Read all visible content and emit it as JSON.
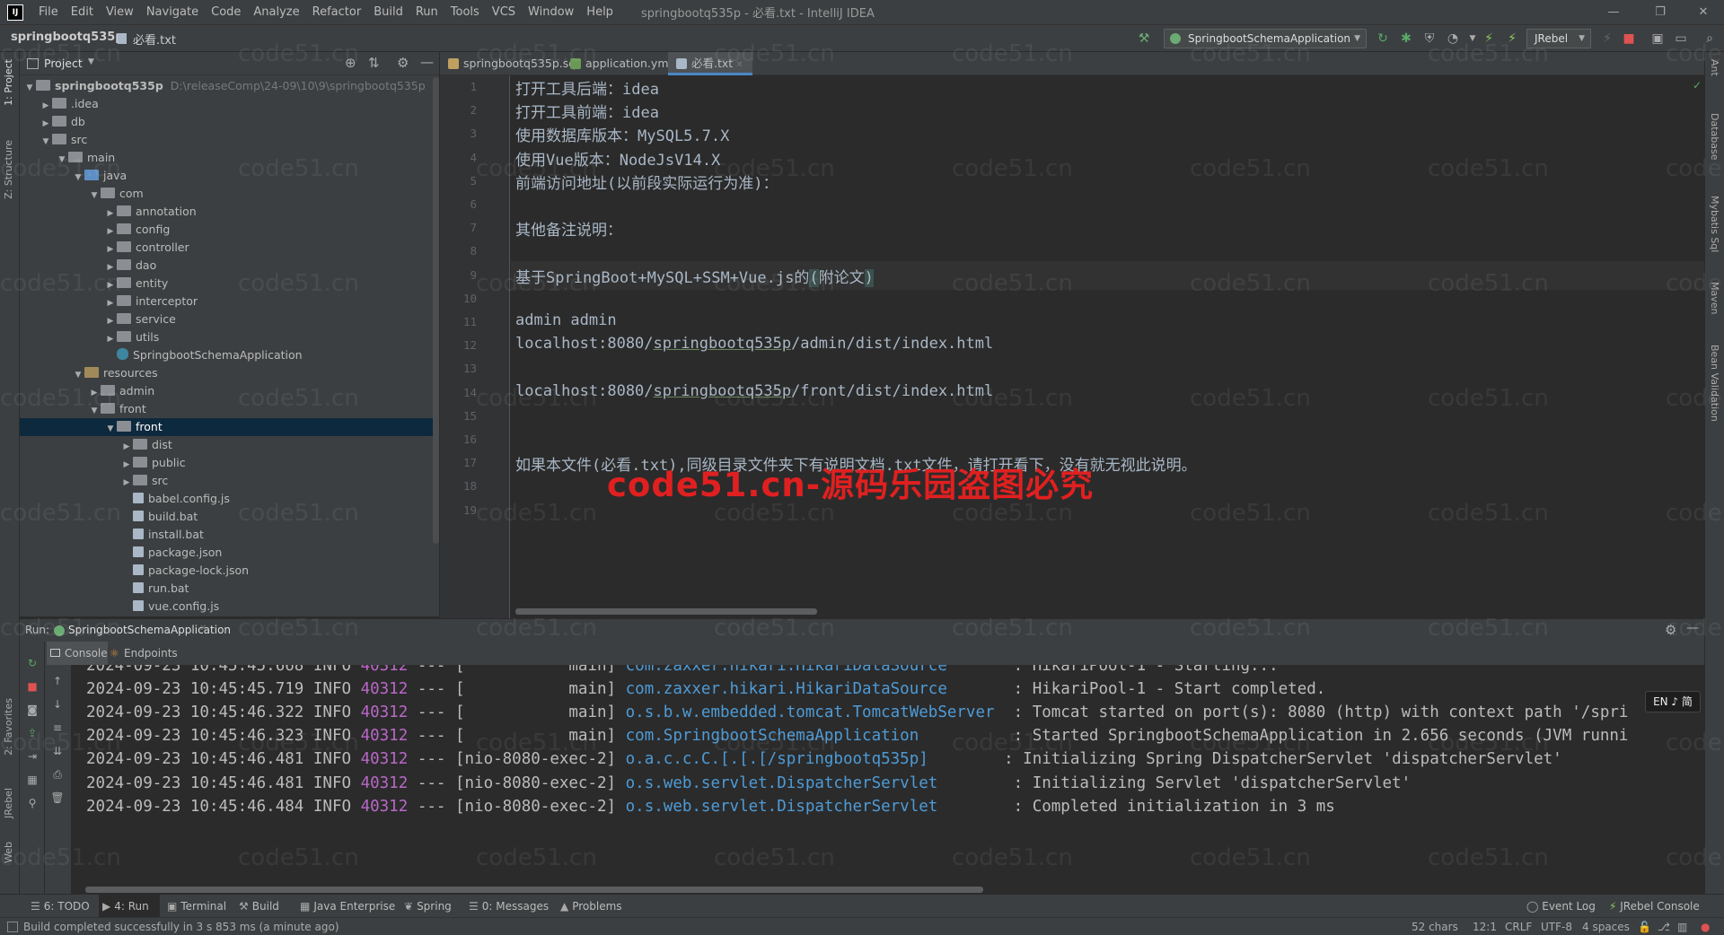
{
  "app": {
    "menu": [
      "File",
      "Edit",
      "View",
      "Navigate",
      "Code",
      "Analyze",
      "Refactor",
      "Build",
      "Run",
      "Tools",
      "VCS",
      "Window",
      "Help"
    ],
    "window_title": "springbootq535p - 必看.txt - IntelliJ IDEA"
  },
  "navbar": {
    "project": "springbootq535p",
    "file": "必看.txt",
    "run_config": "SpringbootSchemaApplication",
    "jrebel": "JRebel"
  },
  "left_strip": {
    "tabs": [
      "1: Project",
      "Z: Structure",
      "2: Favorites",
      "JRebel",
      "Web"
    ]
  },
  "right_strip": {
    "tabs": [
      "Ant",
      "Database",
      "Mybatis Sql",
      "Maven",
      "Bean Validation"
    ]
  },
  "project_panel": {
    "title": "Project",
    "tree": [
      {
        "label": "springbootq535p",
        "path": "D:\\releaseComp\\24-09\\10\\9\\springbootq535p",
        "indent": 0,
        "arrow": "▼",
        "icon": "folder",
        "bold": true
      },
      {
        "label": ".idea",
        "indent": 1,
        "arrow": "▶",
        "icon": "folder"
      },
      {
        "label": "db",
        "indent": 1,
        "arrow": "▶",
        "icon": "folder"
      },
      {
        "label": "src",
        "indent": 1,
        "arrow": "▼",
        "icon": "folder"
      },
      {
        "label": "main",
        "indent": 2,
        "arrow": "▼",
        "icon": "folder"
      },
      {
        "label": "java",
        "indent": 3,
        "arrow": "▼",
        "icon": "src"
      },
      {
        "label": "com",
        "indent": 4,
        "arrow": "▼",
        "icon": "folder"
      },
      {
        "label": "annotation",
        "indent": 5,
        "arrow": "▶",
        "icon": "folder"
      },
      {
        "label": "config",
        "indent": 5,
        "arrow": "▶",
        "icon": "folder"
      },
      {
        "label": "controller",
        "indent": 5,
        "arrow": "▶",
        "icon": "folder"
      },
      {
        "label": "dao",
        "indent": 5,
        "arrow": "▶",
        "icon": "folder"
      },
      {
        "label": "entity",
        "indent": 5,
        "arrow": "▶",
        "icon": "folder"
      },
      {
        "label": "interceptor",
        "indent": 5,
        "arrow": "▶",
        "icon": "folder"
      },
      {
        "label": "service",
        "indent": 5,
        "arrow": "▶",
        "icon": "folder"
      },
      {
        "label": "utils",
        "indent": 5,
        "arrow": "▶",
        "icon": "folder"
      },
      {
        "label": "SpringbootSchemaApplication",
        "indent": 5,
        "arrow": "",
        "icon": "class"
      },
      {
        "label": "resources",
        "indent": 3,
        "arrow": "▼",
        "icon": "res"
      },
      {
        "label": "admin",
        "indent": 4,
        "arrow": "▶",
        "icon": "folder"
      },
      {
        "label": "front",
        "indent": 4,
        "arrow": "▼",
        "icon": "folder"
      },
      {
        "label": "front",
        "indent": 5,
        "arrow": "▼",
        "icon": "folder",
        "selected": true
      },
      {
        "label": "dist",
        "indent": 6,
        "arrow": "▶",
        "icon": "folder"
      },
      {
        "label": "public",
        "indent": 6,
        "arrow": "▶",
        "icon": "folder"
      },
      {
        "label": "src",
        "indent": 6,
        "arrow": "▶",
        "icon": "folder"
      },
      {
        "label": "babel.config.js",
        "indent": 6,
        "arrow": "",
        "icon": "file"
      },
      {
        "label": "build.bat",
        "indent": 6,
        "arrow": "",
        "icon": "file"
      },
      {
        "label": "install.bat",
        "indent": 6,
        "arrow": "",
        "icon": "file"
      },
      {
        "label": "package.json",
        "indent": 6,
        "arrow": "",
        "icon": "file"
      },
      {
        "label": "package-lock.json",
        "indent": 6,
        "arrow": "",
        "icon": "file"
      },
      {
        "label": "run.bat",
        "indent": 6,
        "arrow": "",
        "icon": "file"
      },
      {
        "label": "vue.config.js",
        "indent": 6,
        "arrow": "",
        "icon": "file"
      }
    ]
  },
  "editor": {
    "tabs": [
      {
        "label": "springbootq535p.sql",
        "color": "#c0a060"
      },
      {
        "label": "application.yml",
        "color": "#6a9955"
      },
      {
        "label": "必看.txt",
        "color": "#a9b7c6",
        "active": true
      }
    ],
    "current_line": 9,
    "lines": [
      "打开工具后端：idea",
      "打开工具前端：idea",
      "使用数据库版本：MySQL5.7.X",
      "使用Vue版本：NodeJsV14.X",
      "前端访问地址(以前段实际运行为准)：",
      "",
      "其他备注说明：",
      "",
      "基于SpringBoot+MySQL+SSM+Vue.js的(附论文)",
      "",
      "admin admin",
      "localhost:8080/springbootq535p/admin/dist/index.html",
      "",
      "localhost:8080/springbootq535p/front/dist/index.html",
      "",
      "",
      "如果本文件(必看.txt),同级目录文件夹下有说明文档.txt文件，请打开看下，没有就无视此说明。",
      "",
      ""
    ],
    "red_watermark": "code51.cn-源码乐园盗图必究",
    "watermark": "code51.cn"
  },
  "run_panel": {
    "label": "Run:",
    "config": "SpringbootSchemaApplication",
    "tabs": [
      "Console",
      "Endpoints"
    ],
    "ime_badge": "EN ♪ 简",
    "log": [
      {
        "ts": "2024-09-23 10:45:45.668",
        "level": "INFO",
        "pid": "40312",
        "sep": "---",
        "thread": "[           main]",
        "cls": "com.zaxxer.hikari.HikariDataSource      ",
        "msg": ": HikariPool-1 - Starting..."
      },
      {
        "ts": "2024-09-23 10:45:45.719",
        "level": "INFO",
        "pid": "40312",
        "sep": "---",
        "thread": "[           main]",
        "cls": "com.zaxxer.hikari.HikariDataSource      ",
        "msg": ": HikariPool-1 - Start completed."
      },
      {
        "ts": "2024-09-23 10:45:46.322",
        "level": "INFO",
        "pid": "40312",
        "sep": "---",
        "thread": "[           main]",
        "cls": "o.s.b.w.embedded.tomcat.TomcatWebServer ",
        "msg": ": Tomcat started on port(s): 8080 (http) with context path '/spri"
      },
      {
        "ts": "2024-09-23 10:45:46.323",
        "level": "INFO",
        "pid": "40312",
        "sep": "---",
        "thread": "[           main]",
        "cls": "com.SpringbootSchemaApplication         ",
        "msg": ": Started SpringbootSchemaApplication in 2.656 seconds (JVM runni"
      },
      {
        "ts": "2024-09-23 10:45:46.481",
        "level": "INFO",
        "pid": "40312",
        "sep": "---",
        "thread": "[nio-8080-exec-2]",
        "cls": "o.a.c.c.C.[.[.[/springbootq535p]       ",
        "msg": ": Initializing Spring DispatcherServlet 'dispatcherServlet'"
      },
      {
        "ts": "2024-09-23 10:45:46.481",
        "level": "INFO",
        "pid": "40312",
        "sep": "---",
        "thread": "[nio-8080-exec-2]",
        "cls": "o.s.web.servlet.DispatcherServlet       ",
        "msg": ": Initializing Servlet 'dispatcherServlet'"
      },
      {
        "ts": "2024-09-23 10:45:46.484",
        "level": "INFO",
        "pid": "40312",
        "sep": "---",
        "thread": "[nio-8080-exec-2]",
        "cls": "o.s.web.servlet.DispatcherServlet       ",
        "msg": ": Completed initialization in 3 ms"
      }
    ]
  },
  "tool_tabs": [
    {
      "label": "6: TODO",
      "icon": "☰"
    },
    {
      "label": "4: Run",
      "icon": "▶",
      "active": true
    },
    {
      "label": "Terminal",
      "icon": "▣"
    },
    {
      "label": "Build",
      "icon": "⚒"
    },
    {
      "label": "Java Enterprise",
      "icon": "▦"
    },
    {
      "label": "Spring",
      "icon": "❦"
    },
    {
      "label": "0: Messages",
      "icon": "☰"
    },
    {
      "label": "Problems",
      "icon": "▲"
    }
  ],
  "tool_tabs_right": {
    "event_log": "Event Log",
    "jrebel_console": "JRebel Console"
  },
  "status": {
    "message": "Build completed successfully in 3 s 853 ms (a minute ago)",
    "chars": "52 chars",
    "position": "12:1",
    "line_sep": "CRLF",
    "encoding": "UTF-8",
    "indent": "4 spaces"
  },
  "colors": {
    "accent": "#4a88c7",
    "log_pid": "#b968c7",
    "log_class": "#4e9bd6",
    "watermark_red": "#e02020"
  }
}
